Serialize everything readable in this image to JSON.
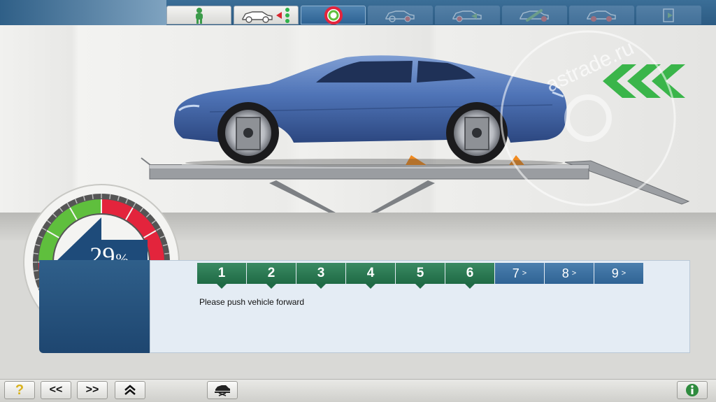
{
  "nav_tabs": [
    {
      "name": "customer",
      "state": "done"
    },
    {
      "name": "vehicle",
      "state": "done"
    },
    {
      "name": "runout-compensation",
      "state": "active"
    },
    {
      "name": "measurement",
      "state": "disabled"
    },
    {
      "name": "results",
      "state": "disabled"
    },
    {
      "name": "adjustment",
      "state": "disabled"
    },
    {
      "name": "final-check",
      "state": "disabled"
    },
    {
      "name": "print",
      "state": "disabled"
    }
  ],
  "watermark": {
    "text": "astrade.ru"
  },
  "gauge": {
    "percent_value": "29",
    "percent_unit": "%",
    "progress": 0.29,
    "direction": "forward",
    "colors": {
      "ok": "#5fbf3d",
      "bad": "#e3243c",
      "arrow": "#1e4b7a"
    }
  },
  "steps": [
    {
      "label": "1",
      "state": "done"
    },
    {
      "label": "2",
      "state": "done"
    },
    {
      "label": "3",
      "state": "done"
    },
    {
      "label": "4",
      "state": "done"
    },
    {
      "label": "5",
      "state": "done"
    },
    {
      "label": "6",
      "state": "done"
    },
    {
      "label": "7",
      "state": "todo"
    },
    {
      "label": "8",
      "state": "todo"
    },
    {
      "label": "9",
      "state": "todo"
    }
  ],
  "step_chevron": ">",
  "instruction": "Please push vehicle forward",
  "bottom_toolbar": {
    "help": "?",
    "back": "<<",
    "forward": ">>",
    "collapse": "⌃"
  },
  "colors": {
    "accent": "#2d6293",
    "done_green": "#1f6a45",
    "indicator_green": "#2fb24a"
  }
}
